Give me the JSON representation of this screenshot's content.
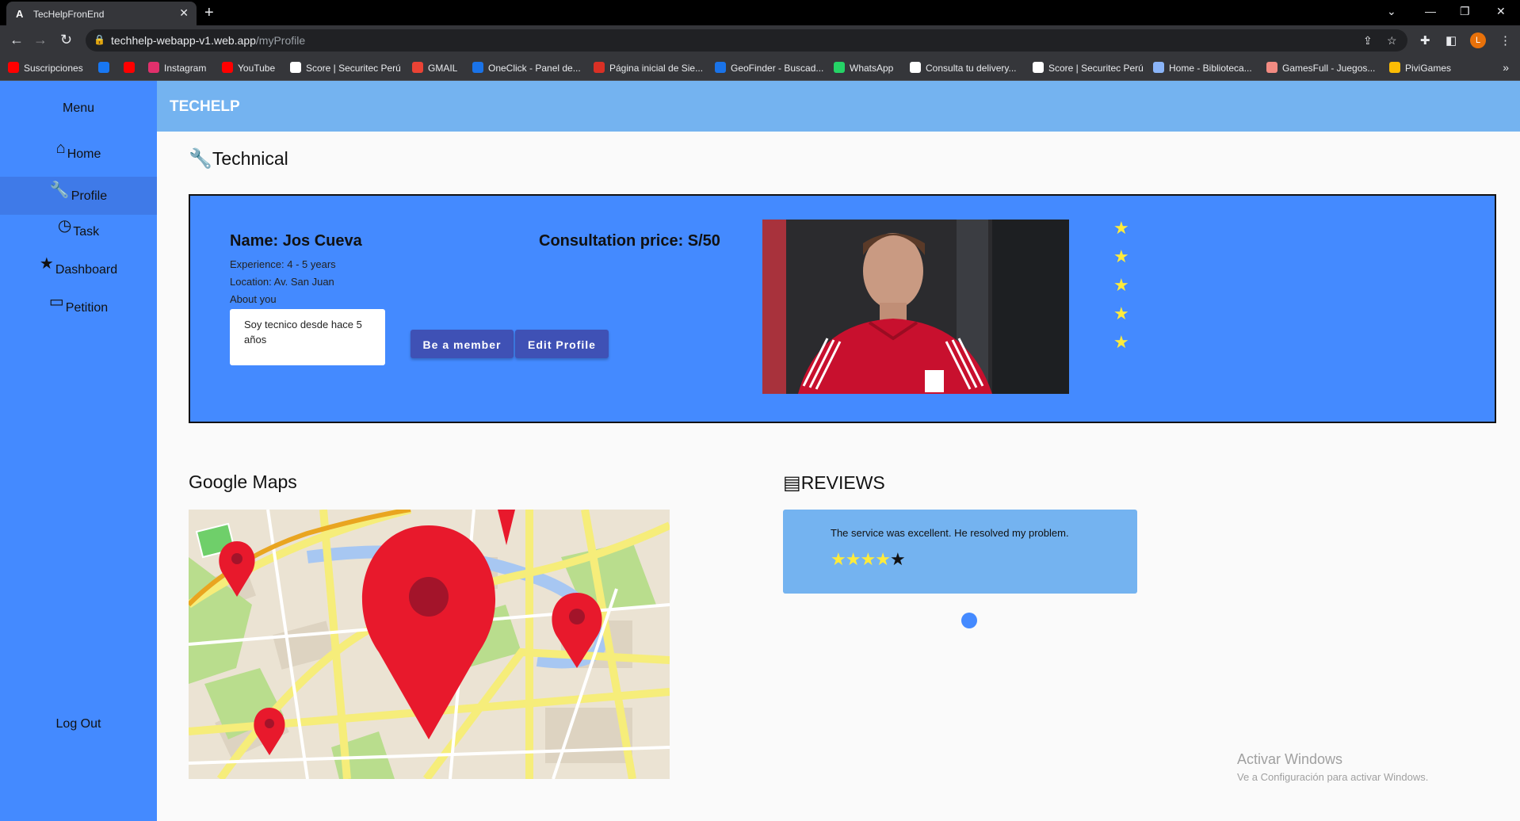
{
  "browser": {
    "tab_title": "TecHelpFronEnd",
    "tab_close": "✕",
    "new_tab": "+",
    "url_host": "techhelp-webapp-v1.web.app",
    "url_path": "/myProfile",
    "profile_initial": "L",
    "bookmarks": [
      {
        "label": "Suscripciones",
        "color": "#ff0000"
      },
      {
        "label": "",
        "color": "#1877f2"
      },
      {
        "label": "",
        "color": "#ff0000"
      },
      {
        "label": "Instagram",
        "color": "#e1306c"
      },
      {
        "label": "YouTube",
        "color": "#ff0000"
      },
      {
        "label": "Score | Securitec Perú",
        "color": "#ffffff"
      },
      {
        "label": "GMAIL",
        "color": "#ea4335"
      },
      {
        "label": "OneClick - Panel de...",
        "color": "#1a73e8"
      },
      {
        "label": "Página inicial de Sie...",
        "color": "#d93025"
      },
      {
        "label": "GeoFinder - Buscad...",
        "color": "#1a73e8"
      },
      {
        "label": "WhatsApp",
        "color": "#25d366"
      },
      {
        "label": "Consulta tu delivery...",
        "color": "#ffffff"
      },
      {
        "label": "Score | Securitec Perú",
        "color": "#ffffff"
      },
      {
        "label": "Home - Biblioteca...",
        "color": "#8ab4f8"
      },
      {
        "label": "GamesFull - Juegos...",
        "color": "#f28b82"
      },
      {
        "label": "PiviGames",
        "color": "#fbbc04"
      }
    ]
  },
  "sidenav": {
    "menu_title": "Menu",
    "items": [
      {
        "label": "Home",
        "icon": "⌂"
      },
      {
        "label": "Profile",
        "icon": "🔧"
      },
      {
        "label": "Task",
        "icon": "◷"
      },
      {
        "label": "Dashboard",
        "icon": "★"
      },
      {
        "label": "Petition",
        "icon": "▭"
      }
    ],
    "logout": "Log Out"
  },
  "header": {
    "brand": "TECHELP"
  },
  "technical": {
    "section_title": "Technical",
    "name": "Name: Jos Cueva",
    "experience": "Experience: 4 - 5 years",
    "location": "Location: Av. San Juan",
    "about_label": "About you",
    "about_text": "Soy tecnico desde hace 5 años",
    "price": "Consultation price: S/50",
    "member_button": "Be a member",
    "edit_button": "Edit Profile",
    "rating_stars": 5,
    "star_color": "#ffeb3b"
  },
  "maps": {
    "title": "Google Maps"
  },
  "reviews": {
    "title": "REVIEWS",
    "items": [
      {
        "text": "The service was excellent. He resolved my problem.",
        "rating": 4,
        "max": 5
      }
    ]
  },
  "watermark": {
    "line1": "Activar Windows",
    "line2": "Ve a Configuración para activar Windows."
  },
  "colors": {
    "sidenav": "#448aff",
    "topbar": "#74b3f0",
    "button": "#3f51b5"
  }
}
